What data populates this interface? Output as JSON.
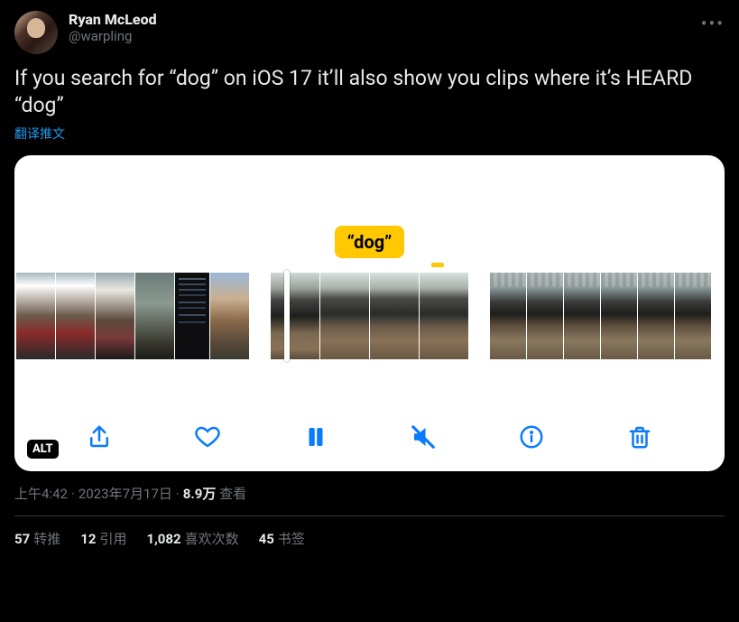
{
  "author": {
    "display_name": "Ryan McLeod",
    "handle": "@warpling"
  },
  "tweet_text": "If you search for “dog” on iOS 17 it’ll also show you clips where it’s HEARD “dog”",
  "translate_label": "翻译推文",
  "media": {
    "caption_bubble": "“dog”",
    "alt_badge": "ALT",
    "toolbar": {
      "share": "share-icon",
      "like": "heart-icon",
      "pause": "pause-icon",
      "mute": "mute-icon",
      "info": "info-icon",
      "trash": "trash-icon"
    }
  },
  "meta": {
    "time": "上午4:42",
    "date": "2023年7月17日",
    "views_count": "8.9万",
    "views_label": "查看"
  },
  "stats": {
    "retweets": {
      "count": "57",
      "label": "转推"
    },
    "quotes": {
      "count": "12",
      "label": "引用"
    },
    "likes": {
      "count": "1,082",
      "label": "喜欢次数"
    },
    "bookmarks": {
      "count": "45",
      "label": "书签"
    }
  }
}
